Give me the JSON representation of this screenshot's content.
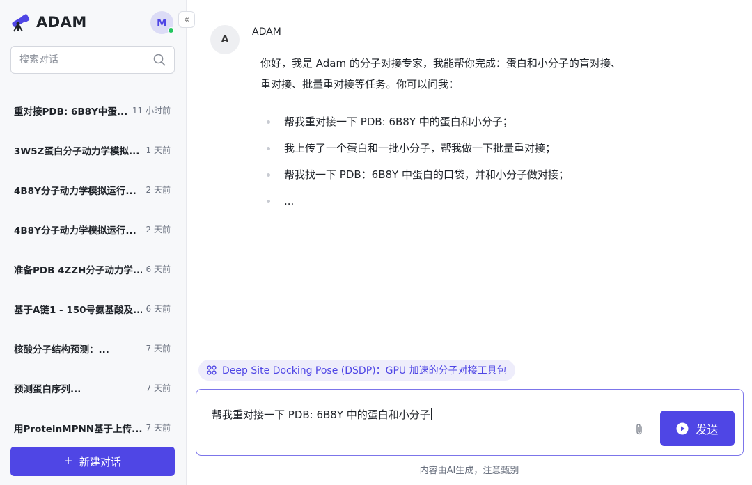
{
  "sidebar": {
    "brand_name": "ADAM",
    "avatar_initial": "M",
    "collapse_glyph": "«",
    "search_placeholder": "搜索对话",
    "history": [
      {
        "title": "重对接PDB: 6B8Y中蛋...",
        "time": "11 小时前"
      },
      {
        "title": "3W5Z蛋白分子动力学模拟...",
        "time": "1 天前"
      },
      {
        "title": "4B8Y分子动力学模拟运行...",
        "time": "2 天前"
      },
      {
        "title": "4B8Y分子动力学模拟运行...",
        "time": "2 天前"
      },
      {
        "title": "准备PDB 4ZZH分子动力学...",
        "time": "6 天前"
      },
      {
        "title": "基于A链1 - 150号氨基酸及...",
        "time": "6 天前"
      },
      {
        "title": "核酸分子结构预测：...",
        "time": "7 天前"
      },
      {
        "title": "预测蛋白序列...",
        "time": "7 天前"
      },
      {
        "title": "用ProteinMPNN基于上传...",
        "time": "7 天前"
      }
    ],
    "new_chat_label": "新建对话",
    "new_chat_icon": "+"
  },
  "chat": {
    "bot_initial": "A",
    "bot_name": "ADAM",
    "intro_line1": "你好，我是 Adam 的分子对接专家，我能帮你完成：蛋白和小分子的盲对接、",
    "intro_line2": "重对接、批量重对接等任务。你可以问我：",
    "suggestions": [
      "帮我重对接一下 PDB: 6B8Y 中的蛋白和小分子；",
      "我上传了一个蛋白和一批小分子，帮我做一下批量重对接；",
      "帮我找一下 PDB：6B8Y 中蛋白的口袋，并和小分子做对接；",
      "..."
    ]
  },
  "composer": {
    "tool_chip": "Deep Site Docking Pose (DSDP)：GPU 加速的分子对接工具包",
    "input_value": "帮我重对接一下 PDB: 6B8Y 中的蛋白和小分子",
    "send_label": "发送",
    "disclaimer": "内容由AI生成，注意甄别"
  },
  "colors": {
    "accent": "#4f46e5",
    "online": "#22c55e",
    "chip_bg": "#eeedfb"
  }
}
